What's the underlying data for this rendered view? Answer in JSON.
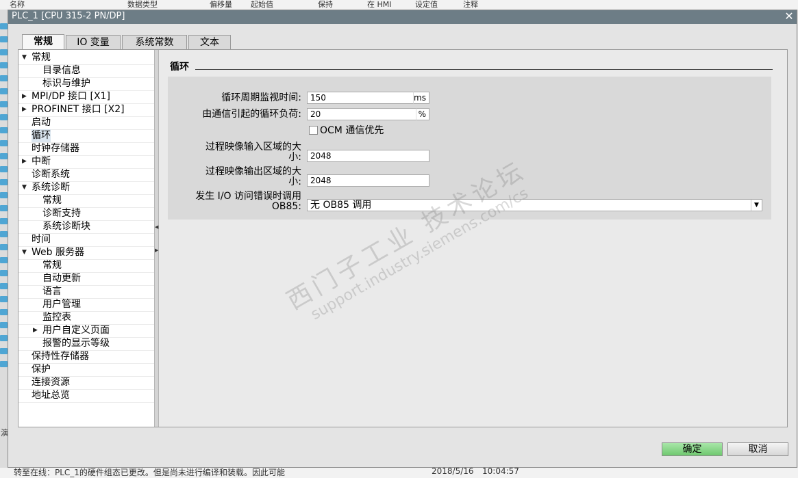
{
  "background": {
    "header_columns": [
      "名称",
      "数据类型",
      "偏移量",
      "起始值",
      "保持",
      "在 HMI",
      "设定值",
      "注释"
    ],
    "status_text": "转至在线：PLC_1的硬件组态已更改。但是尚未进行编译和装载。因此可能",
    "status_date": "2018/5/16",
    "status_time": "10:04:57",
    "side_label": "演"
  },
  "dialog": {
    "title": "PLC_1 [CPU 315-2 PN/DP]",
    "close_glyph": "✕"
  },
  "tabs": [
    {
      "label": "常规",
      "active": true
    },
    {
      "label": "IO 变量",
      "active": false
    },
    {
      "label": "系统常数",
      "active": false
    },
    {
      "label": "文本",
      "active": false
    }
  ],
  "nav": [
    {
      "label": "常规",
      "arrow": "▼"
    },
    {
      "label": "目录信息",
      "arrow": ""
    },
    {
      "label": "标识与维护",
      "arrow": ""
    },
    {
      "label": "MPI/DP 接口 [X1]",
      "arrow": "▶"
    },
    {
      "label": "PROFINET 接口 [X2]",
      "arrow": "▶"
    },
    {
      "label": "启动",
      "arrow": ""
    },
    {
      "label": "循环",
      "arrow": "",
      "selected": true
    },
    {
      "label": "时钟存储器",
      "arrow": ""
    },
    {
      "label": "中断",
      "arrow": "▶"
    },
    {
      "label": "诊断系统",
      "arrow": ""
    },
    {
      "label": "系统诊断",
      "arrow": "▼"
    },
    {
      "label": "常规",
      "arrow": ""
    },
    {
      "label": "诊断支持",
      "arrow": ""
    },
    {
      "label": "系统诊断块",
      "arrow": ""
    },
    {
      "label": "时间",
      "arrow": ""
    },
    {
      "label": "Web 服务器",
      "arrow": "▼"
    },
    {
      "label": "常规",
      "arrow": ""
    },
    {
      "label": "自动更新",
      "arrow": ""
    },
    {
      "label": "语言",
      "arrow": ""
    },
    {
      "label": "用户管理",
      "arrow": ""
    },
    {
      "label": "监控表",
      "arrow": ""
    },
    {
      "label": "用户自定义页面",
      "arrow": "▶"
    },
    {
      "label": "报警的显示等级",
      "arrow": ""
    },
    {
      "label": "保持性存储器",
      "arrow": ""
    },
    {
      "label": "保护",
      "arrow": ""
    },
    {
      "label": "连接资源",
      "arrow": ""
    },
    {
      "label": "地址总览",
      "arrow": ""
    }
  ],
  "splitter": {
    "collapse_glyph": "◀",
    "expand_glyph": "▶"
  },
  "section": {
    "title": "循环",
    "fields": {
      "cycle_monitor": {
        "label": "循环周期监视时间:",
        "value": "150",
        "unit": "ms"
      },
      "comm_load": {
        "label": "由通信引起的循环负荷:",
        "value": "20",
        "unit": "%"
      },
      "ocm_priority": {
        "label": "OCM 通信优先",
        "checked": false
      },
      "pi_input": {
        "label_line1": "过程映像输入区域的大",
        "label_line2": "小:",
        "value": "2048"
      },
      "pi_output": {
        "label_line1": "过程映像输出区域的大",
        "label_line2": "小:",
        "value": "2048"
      },
      "io_error": {
        "label_line1": "发生 I/O 访问错误时调用",
        "label_line2": "OB85:",
        "value": "无 OB85 调用",
        "dropdown_glyph": "▼"
      }
    }
  },
  "watermark": {
    "line1": "西门子工业 技术论坛",
    "line2": "support.industry.siemens.com/cs"
  },
  "buttons": {
    "ok": "确定",
    "cancel": "取消"
  }
}
